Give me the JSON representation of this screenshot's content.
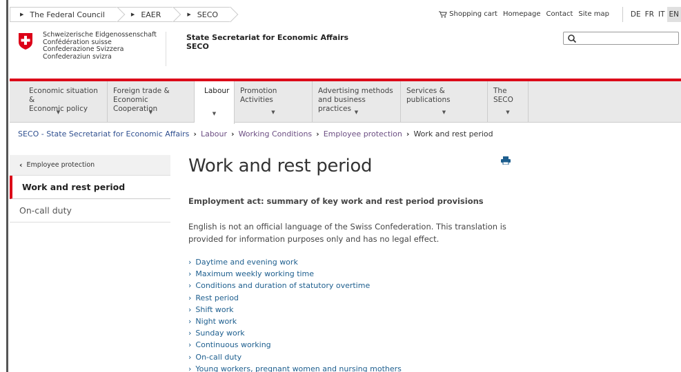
{
  "top_breadcrumbs": [
    "The Federal Council",
    "EAER",
    "SECO"
  ],
  "top_links": {
    "cart": "Shopping cart",
    "homepage": "Homepage",
    "contact": "Contact",
    "sitemap": "Site map"
  },
  "languages": [
    {
      "code": "DE",
      "active": false
    },
    {
      "code": "FR",
      "active": false
    },
    {
      "code": "IT",
      "active": false
    },
    {
      "code": "EN",
      "active": true
    }
  ],
  "confederation_lines": [
    "Schweizerische Eidgenossenschaft",
    "Confédération suisse",
    "Confederazione Svizzera",
    "Confederaziun svizra"
  ],
  "secretariat": {
    "line1": "State Secretariat for Economic Affairs",
    "line2": "SECO"
  },
  "search": {
    "placeholder": ""
  },
  "main_nav": [
    {
      "line1": "Economic situation &",
      "line2": "Economic policy"
    },
    {
      "line1": "Foreign trade &",
      "line2": "Economic Cooperation"
    },
    {
      "line1": "Labour",
      "line2": "",
      "active": true
    },
    {
      "line1": "Promotion Activities",
      "line2": ""
    },
    {
      "line1": "Advertising methods",
      "line2": "and business practices"
    },
    {
      "line1": "Services & publications",
      "line2": ""
    },
    {
      "line1": "The SECO",
      "line2": ""
    }
  ],
  "breadcrumb": [
    "SECO - State Secretariat for Economic Affairs",
    "Labour",
    "Working Conditions",
    "Employee protection",
    "Work and rest period"
  ],
  "sidebar": {
    "back": "Employee protection",
    "active": "Work and rest period",
    "items": [
      "On-call duty"
    ]
  },
  "content": {
    "title": "Work and rest period",
    "lead": "Employment act: summary of key work and rest period provisions",
    "note": "English is not an official language of the Swiss Confederation. This translation is provided for information purposes only and has no legal effect.",
    "links": [
      "Daytime and evening work",
      "Maximum weekly working time",
      "Conditions and duration of statutory overtime",
      "Rest period",
      "Shift work",
      "Night work",
      "Sunday work",
      "Continuous working",
      "On-call duty",
      "Young workers, pregnant women and nursing mothers"
    ]
  },
  "colors": {
    "accent_red": "#dc0018",
    "link_blue": "#1d5e8e",
    "breadcrumb_purple": "#6b4d82"
  }
}
